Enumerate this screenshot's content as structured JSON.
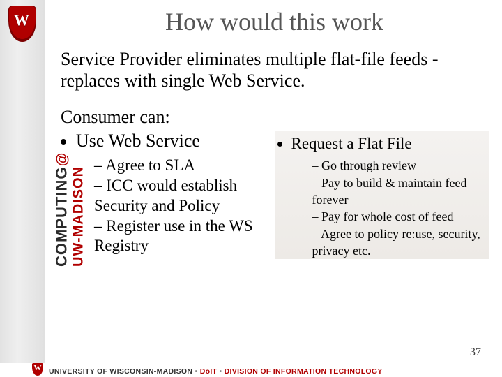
{
  "sidebar": {
    "crest_letter": "W",
    "vertical_computing": "COMPUTING",
    "vertical_at": "@",
    "vertical_uw": "UW-MADISON"
  },
  "title": "How would this work",
  "intro": "Service Provider eliminates multiple flat-file feeds - replaces with single Web Service.",
  "consumer_label": "Consumer can:",
  "left": {
    "bullet": "Use Web Service",
    "subs": {
      "a": "Agree to SLA",
      "b": "ICC would establish Security and Policy",
      "c": "Register use in the WS Registry"
    }
  },
  "right": {
    "bullet": "Request a Flat File",
    "subs": {
      "a": "Go through review",
      "b": "Pay to build & maintain feed forever",
      "c": "Pay for whole cost of feed",
      "d": "Agree to policy re:use, security, privacy etc."
    }
  },
  "page_number": "37",
  "footer": {
    "inst": "UNIVERSITY OF WISCONSIN-MADISON",
    "sep1": " • ",
    "doit": "DoIT",
    "sep2": " • ",
    "div": "DIVISION OF INFORMATION TECHNOLOGY"
  }
}
